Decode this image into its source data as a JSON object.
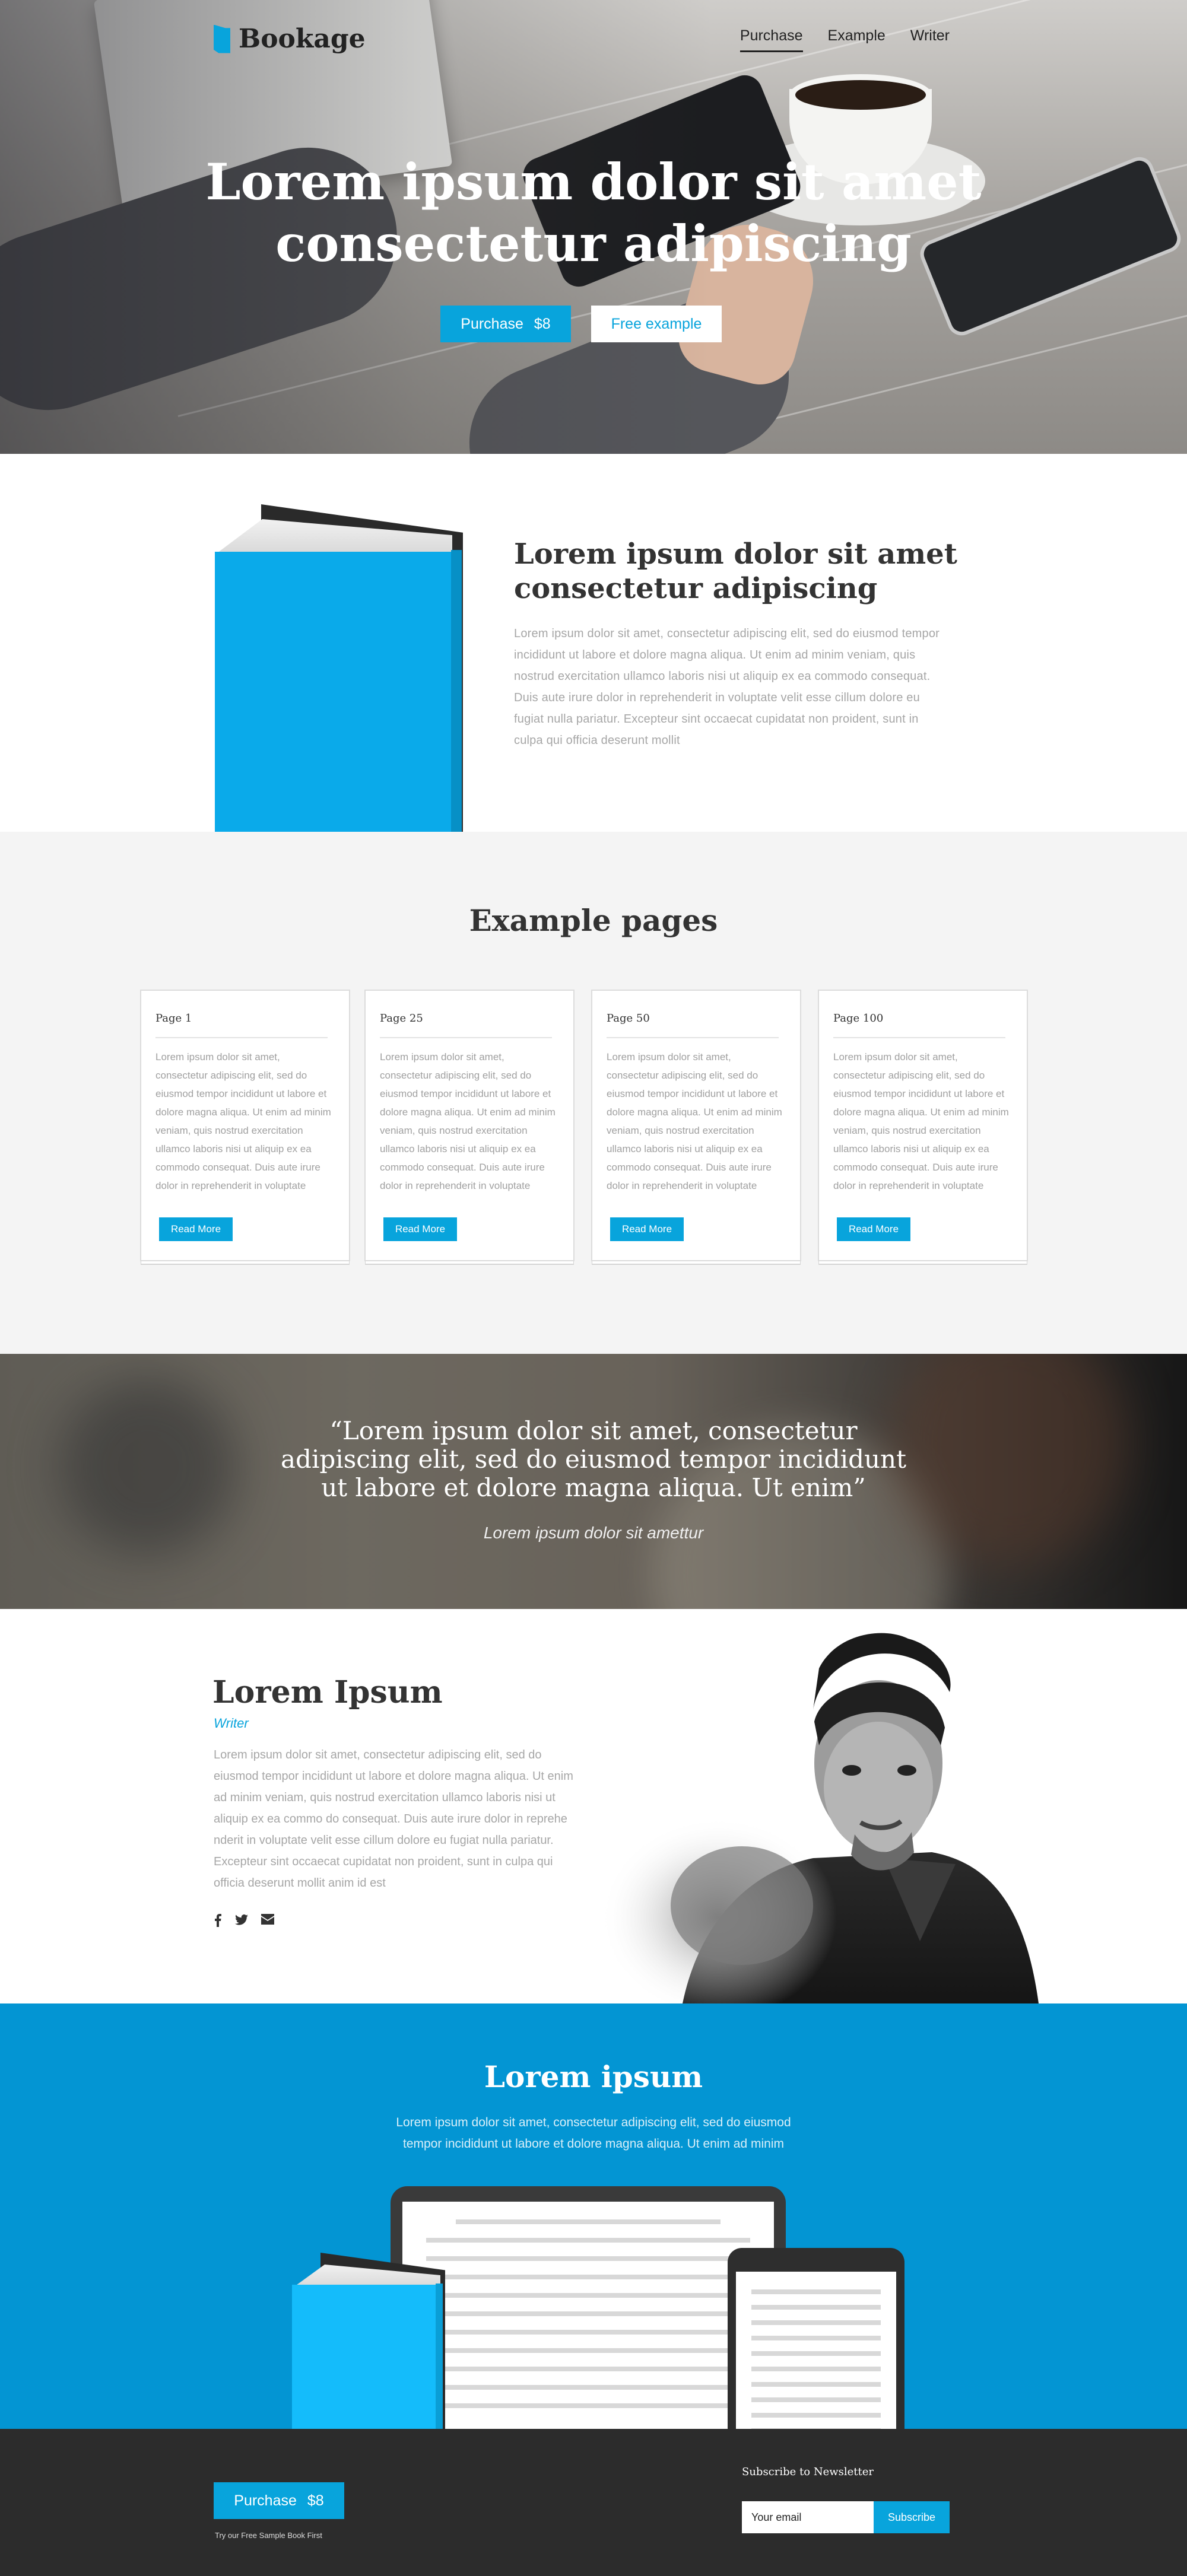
{
  "brand": {
    "name": "Bookage",
    "accent": "#08a4dc",
    "dark": "#2c2c2c"
  },
  "nav": {
    "items": [
      "Purchase",
      "Example",
      "Writer"
    ],
    "active": "Purchase"
  },
  "hero": {
    "title": "Lorem ipsum dolor sit amet consectetur adipiscing",
    "title_line1": "Lorem ipsum dolor sit amet",
    "title_line2": "consectetur adipiscing",
    "buy_label": "Purchase",
    "buy_price": "$8",
    "free_label": "Free example"
  },
  "about": {
    "title_line1": "Lorem ipsum dolor sit amet",
    "title_line2": "consectetur adipiscing",
    "text": "Lorem ipsum dolor sit amet, consectetur adipiscing elit, sed do eiusmod tempor incididunt ut labore et dolore magna aliqua. Ut enim ad minim veniam, quis nostrud exercitation ullamco laboris nisi ut aliquip ex ea commodo consequat. Duis aute irure dolor in reprehenderit in voluptate velit esse cillum dolore eu fugiat nulla pariatur. Excepteur sint occaecat cupidatat non proident, sunt in culpa qui officia deserunt mollit"
  },
  "examples": {
    "title": "Example pages",
    "cards": [
      {
        "title": "Page 1",
        "text": "Lorem ipsum dolor sit amet, consectetur adipiscing elit, sed do eiusmod tempor incididunt ut labore et dolore magna aliqua. Ut enim ad minim veniam, quis nostrud exercitation ullamco laboris nisi ut aliquip ex ea commodo consequat. Duis aute irure dolor in reprehenderit in voluptate",
        "button": "Read More"
      },
      {
        "title": "Page 25",
        "text": "Lorem ipsum dolor sit amet, consectetur adipiscing elit, sed do eiusmod tempor incididunt ut labore et dolore magna aliqua. Ut enim ad minim veniam, quis nostrud exercitation ullamco laboris nisi ut aliquip ex ea commodo consequat. Duis aute irure dolor in reprehenderit in voluptate",
        "button": "Read More"
      },
      {
        "title": "Page 50",
        "text": "Lorem ipsum dolor sit amet, consectetur adipiscing elit, sed do eiusmod tempor incididunt ut labore et dolore magna aliqua. Ut enim ad minim veniam, quis nostrud exercitation ullamco laboris nisi ut aliquip ex ea commodo consequat. Duis aute irure dolor in reprehenderit in voluptate",
        "button": "Read More"
      },
      {
        "title": "Page 100",
        "text": "Lorem ipsum dolor sit amet, consectetur adipiscing elit, sed do eiusmod tempor incididunt ut labore et dolore magna aliqua. Ut enim ad minim veniam, quis nostrud exercitation ullamco laboris nisi ut aliquip ex ea commodo consequat. Duis aute irure dolor in reprehenderit in voluptate",
        "button": "Read More"
      }
    ]
  },
  "quote": {
    "line1": "“Lorem ipsum dolor sit amet, consectetur",
    "line2": "adipiscing elit, sed do eiusmod tempor incididunt",
    "line3": "ut labore et dolore magna aliqua. Ut enim”",
    "author": "Lorem ipsum dolor sit amettur"
  },
  "writer": {
    "name": "Lorem Ipsum",
    "role": "Writer",
    "bio": "Lorem ipsum dolor sit amet, consectetur adipiscing elit, sed do eiusmod tempor incididunt ut labore et dolore magna aliqua. Ut enim ad minim veniam, quis nostrud exercitation ullamco laboris nisi ut aliquip ex ea commo do consequat. Duis aute irure dolor in reprehe nderit in voluptate velit esse cillum dolore eu fugiat nulla pariatur. Excepteur sint occaecat cupidatat non proident, sunt in culpa qui officia deserunt mollit anim id est",
    "social_icons": [
      "facebook-icon",
      "twitter-icon",
      "email-icon"
    ]
  },
  "cta": {
    "title": "Lorem ipsum",
    "text_line1": "Lorem ipsum dolor sit amet, consectetur adipiscing elit, sed do eiusmod",
    "text_line2": "tempor incididunt ut labore et dolore magna aliqua. Ut enim ad minim"
  },
  "footer": {
    "buy_label": "Purchase",
    "buy_price": "$8",
    "note": "Try our Free Sample Book First",
    "newsletter_label": "Subscribe to Newsletter",
    "email_placeholder": "Your email",
    "subscribe_label": "Subscribe"
  }
}
